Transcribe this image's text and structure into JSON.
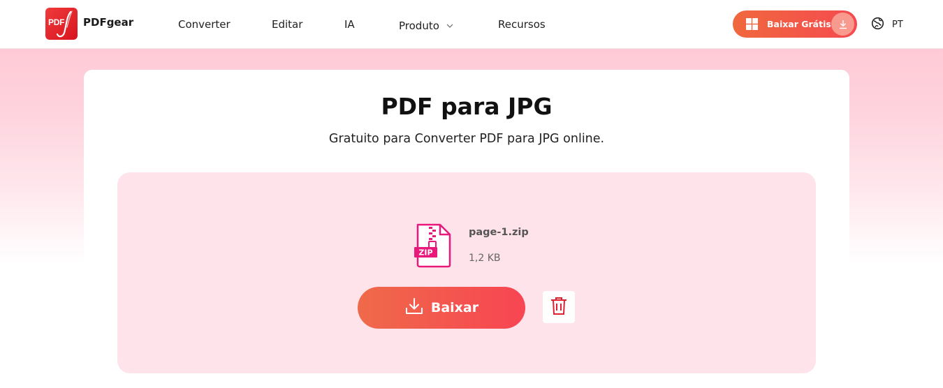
{
  "header": {
    "brand": "PDFgear",
    "logo_text": "PDF",
    "nav": [
      {
        "label": "Converter"
      },
      {
        "label": "Editar"
      },
      {
        "label": "IA"
      },
      {
        "label": "Produto"
      },
      {
        "label": "Recursos"
      }
    ],
    "download_button": "Baixar Grátis",
    "language": "PT"
  },
  "main": {
    "title": "PDF para JPG",
    "subtitle": "Gratuito para Converter PDF para JPG online.",
    "file": {
      "name": "page-1.zip",
      "size": "1,2 KB",
      "type_badge": "ZIP"
    },
    "download_label": "Baixar"
  },
  "colors": {
    "accent": "#f04e4c",
    "accent_gradient_start": "#ef6a4a",
    "accent_gradient_end": "#f84552",
    "zip_icon": "#e8197a",
    "trash_icon": "#e0202f",
    "drop_zone_bg": "#fee3ea",
    "page_bg_top": "#fecad6"
  },
  "icons": {
    "logo": "pdfgear-logo-icon",
    "nav_dropdown": "chevron-down-icon",
    "windows": "windows-icon",
    "download": "download-icon",
    "language": "globe-icon",
    "file": "zip-file-icon",
    "delete": "trash-icon"
  }
}
